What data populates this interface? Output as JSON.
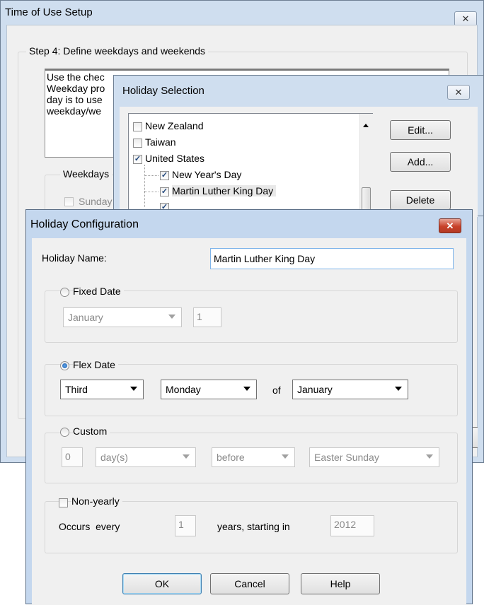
{
  "tou": {
    "title": "Time of Use Setup",
    "close": "✕",
    "step_label": "Step 4: Define weekdays and weekends",
    "info_lines": [
      "Use the chec",
      "Weekday pro",
      "day is to use",
      "weekday/we"
    ],
    "weekdays_label": "Weekdays",
    "sunday_label": "Sunday"
  },
  "holiday_selection": {
    "title": "Holiday Selection",
    "close": "✕",
    "tree": [
      "New Zealand",
      "Taiwan",
      "United States",
      "New Year's Day",
      "Martin Luther King Day"
    ],
    "buttons": {
      "edit": "Edit...",
      "add": "Add...",
      "delete": "Delete"
    }
  },
  "config": {
    "title": "Holiday Configuration",
    "close": "✕",
    "name_label": "Holiday Name:",
    "name_value": "Martin Luther King Day",
    "fixed": {
      "label": "Fixed Date",
      "month": "January",
      "day": "1"
    },
    "flex": {
      "label": "Flex Date",
      "ordinal": "Third",
      "weekday": "Monday",
      "of": "of",
      "month": "January"
    },
    "custom": {
      "label": "Custom",
      "count": "0",
      "unit": "day(s)",
      "relation": "before",
      "reference": "Easter Sunday"
    },
    "nonyearly": {
      "label": "Non-yearly",
      "occurs": "Occurs  every",
      "every": "1",
      "years_text": "years, starting in",
      "start_year": "2012"
    },
    "buttons": {
      "ok": "OK",
      "cancel": "Cancel",
      "help": "Help"
    }
  }
}
